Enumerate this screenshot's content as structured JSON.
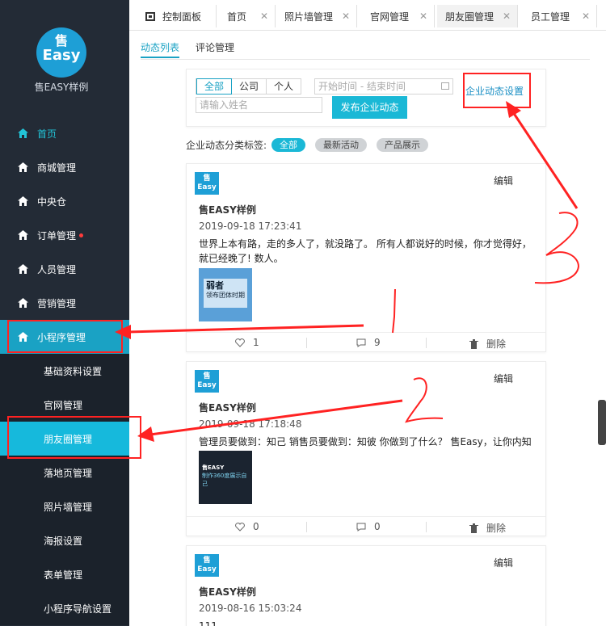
{
  "sidebar": {
    "logo_top": "售",
    "logo_bottom": "Easy",
    "brand": "售EASY样例",
    "items": [
      {
        "label": "首页"
      },
      {
        "label": "商城管理"
      },
      {
        "label": "中央仓"
      },
      {
        "label": "订单管理"
      },
      {
        "label": "人员管理"
      },
      {
        "label": "营销管理"
      },
      {
        "label": "小程序管理"
      }
    ],
    "subitems": [
      {
        "label": "基础资料设置"
      },
      {
        "label": "官网管理"
      },
      {
        "label": "朋友圈管理"
      },
      {
        "label": "落地页管理"
      },
      {
        "label": "照片墙管理"
      },
      {
        "label": "海报设置"
      },
      {
        "label": "表单管理"
      },
      {
        "label": "小程序导航设置"
      }
    ]
  },
  "tabs": [
    {
      "label": "控制面板"
    },
    {
      "label": "首页"
    },
    {
      "label": "照片墙管理"
    },
    {
      "label": "官网管理"
    },
    {
      "label": "朋友圈管理"
    },
    {
      "label": "员工管理"
    }
  ],
  "subtabs": [
    {
      "label": "动态列表"
    },
    {
      "label": "评论管理"
    }
  ],
  "filter": {
    "segments": [
      "全部",
      "公司",
      "个人"
    ],
    "date_placeholder": "开始时间  -  结束时间",
    "name_placeholder": "请输入姓名",
    "publish_label": "发布企业动态",
    "settings_label": "企业动态设置"
  },
  "categories": {
    "label": "企业动态分类标签:",
    "chips": [
      "全部",
      "最新活动",
      "产品展示"
    ]
  },
  "posts": [
    {
      "avatar_top": "售",
      "avatar_bottom": "Easy",
      "edit": "编辑",
      "author": "售EASY样例",
      "time": "2019-09-18 17:23:41",
      "text": "世界上本有路，走的多人了，就没路了。 所有人都说好的时候，你才觉得好，就已经晚了! 数人。",
      "img_line1": "弱者",
      "img_line2": "领布团体时期",
      "likes": "1",
      "comments": "9",
      "delete": "删除"
    },
    {
      "avatar_top": "售",
      "avatar_bottom": "Easy",
      "edit": "编辑",
      "author": "售EASY样例",
      "time": "2019-09-18 17:18:48",
      "text": "管理员要做到：知己 销售员要做到：知彼 你做到了什么？ 售Easy，让你内知己外知彼",
      "img_line1": "售EASY",
      "img_line2": "制作360度展示自己",
      "likes": "0",
      "comments": "0",
      "delete": "删除"
    },
    {
      "avatar_top": "售",
      "avatar_bottom": "Easy",
      "edit": "编辑",
      "author": "售EASY样例",
      "time": "2019-08-16 15:03:24",
      "text": "111"
    }
  ],
  "colors": {
    "sidebar_bg": "#232b36",
    "accent": "#1ab8d6",
    "annotation": "#ff2222"
  }
}
